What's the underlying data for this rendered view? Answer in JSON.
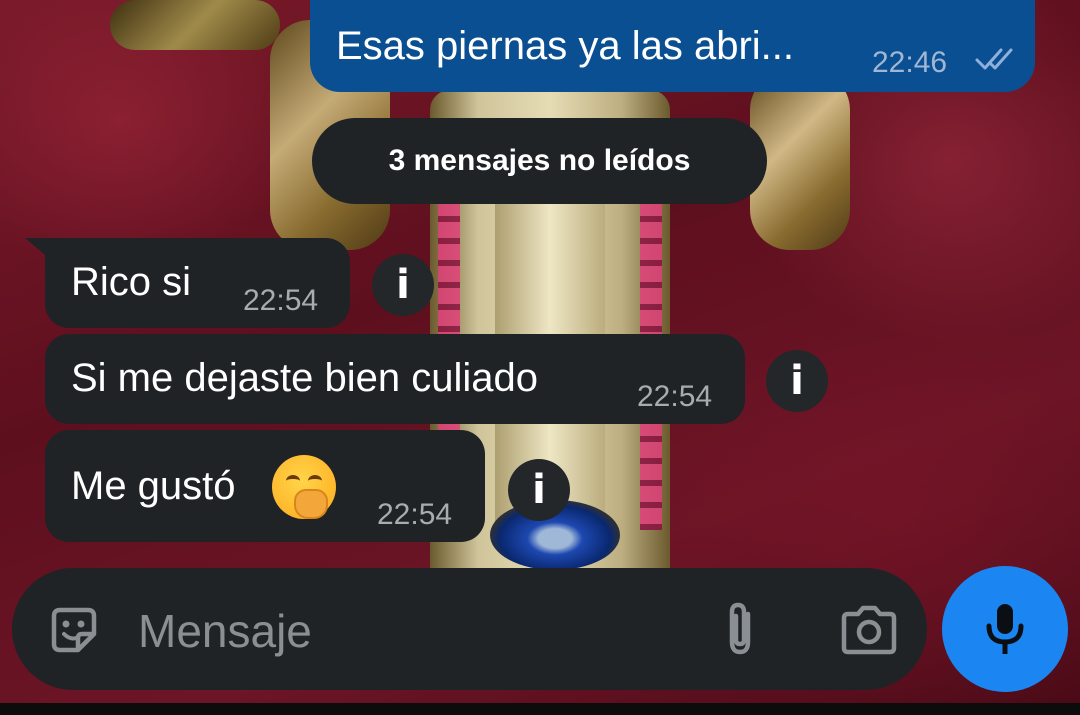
{
  "outgoing": {
    "text": "Esas piernas ya las abri...",
    "time": "22:46",
    "status_icon": "double-check-icon"
  },
  "unread_banner": "3 mensajes no leídos",
  "messages": [
    {
      "text": "Rico si",
      "time": "22:54"
    },
    {
      "text": "Si me dejaste bien culiado",
      "time": "22:54"
    },
    {
      "text": "Me gustó",
      "time": "22:54",
      "emoji": "hand-over-mouth-emoji"
    }
  ],
  "info_icon_glyph": "i",
  "composer": {
    "placeholder": "Mensaje",
    "icons": [
      "sticker-icon",
      "attach-icon",
      "camera-icon",
      "microphone-icon"
    ]
  },
  "colors": {
    "outgoing_bubble": "#0b4f93",
    "incoming_bubble": "#1f2326",
    "mic_button": "#1b86f2",
    "placeholder": "#8a8f94"
  }
}
